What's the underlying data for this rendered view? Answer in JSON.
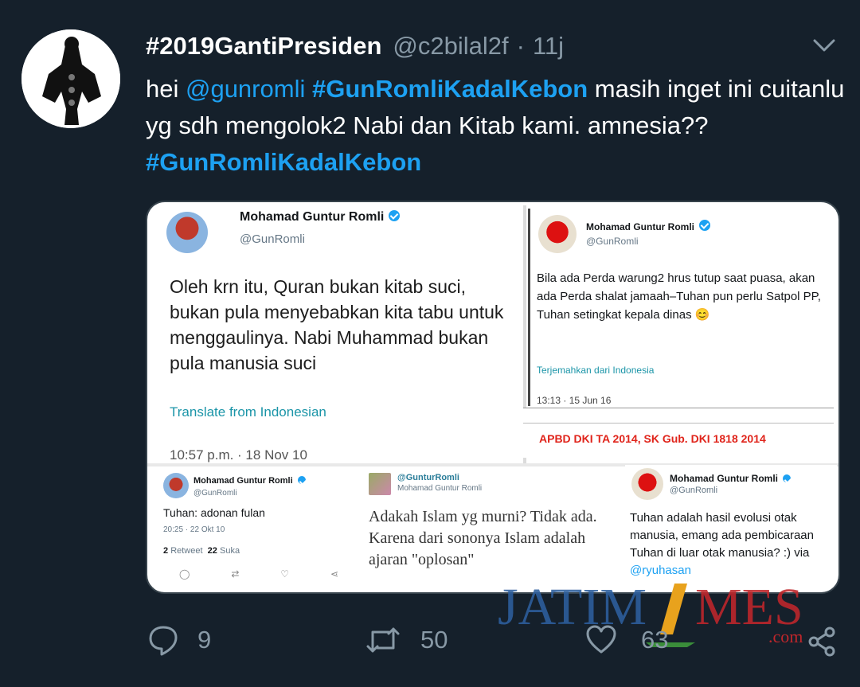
{
  "tweet": {
    "display_name": "#2019GantiPresiden",
    "handle": "@c2bilal2f",
    "separator": "·",
    "time": "11j",
    "text": {
      "t1": "hei ",
      "mention": "@gunromli",
      "t2": " ",
      "hashtag1": "#GunRomliKadalKebon",
      "t3": " masih inget ini cuitanlu yg sdh mengolok2 Nabi dan Kitab kami. amnesia?? ",
      "hashtag2": "#GunRomliKadalKebon"
    }
  },
  "media": {
    "card1": {
      "name": "Mohamad Guntur Romli",
      "handle": "@GunRomli",
      "body": "Oleh krn itu, Quran bukan kitab suci, bukan pula menyebabkan kita tabu untuk menggaulinya. Nabi Muhammad bukan pula manusia suci",
      "translate": "Translate from Indonesian",
      "timestamp": "10:57 p.m. · 18 Nov 10"
    },
    "card2": {
      "name": "Mohamad Guntur Romli",
      "handle": "@GunRomli",
      "body": "Bila ada Perda warung2 hrus tutup saat puasa, akan ada Perda shalat jamaah–Tuhan pun perlu Satpol PP, Tuhan setingkat kepala dinas 😊",
      "translate": "Terjemahkan dari Indonesia",
      "timestamp": "13:13 · 15 Jun 16",
      "strip_caption": "APBD DKI TA 2014, SK Gub. DKI 1818 2014"
    },
    "card3": {
      "name": "Mohamad Guntur Romli",
      "handle": "@GunRomli",
      "body": "Tuhan: adonan fulan",
      "timestamp": "20:25 · 22 Okt 10",
      "retweet_count": "2",
      "retweet_label": "Retweet",
      "like_count": "22",
      "like_label": "Suka"
    },
    "card4": {
      "name": "@GunturRomli",
      "handle": "Mohamad Guntur Romli",
      "body": "Adakah Islam yg murni? Tidak ada. Karena dari sononya Islam adalah ajaran \"oplosan\""
    },
    "card5": {
      "name": "Mohamad Guntur Romli",
      "handle": "@GunRomli",
      "body": "Tuhan adalah hasil evolusi otak manusia, emang ada pembicaraan Tuhan di luar otak manusia? :) via ",
      "via": "@ryuhasan"
    }
  },
  "actions": {
    "reply_count": "9",
    "retweet_count": "50",
    "like_count": "63"
  },
  "watermark": {
    "left": "JATIM",
    "right": "MES",
    "suffix": ".com"
  },
  "colors": {
    "background": "#15202b",
    "accent": "#1da1f2",
    "muted": "#8899a6"
  },
  "icons": [
    "avatar",
    "chevron-down-icon",
    "verified-icon",
    "reply-icon",
    "retweet-icon",
    "like-icon",
    "share-icon"
  ]
}
